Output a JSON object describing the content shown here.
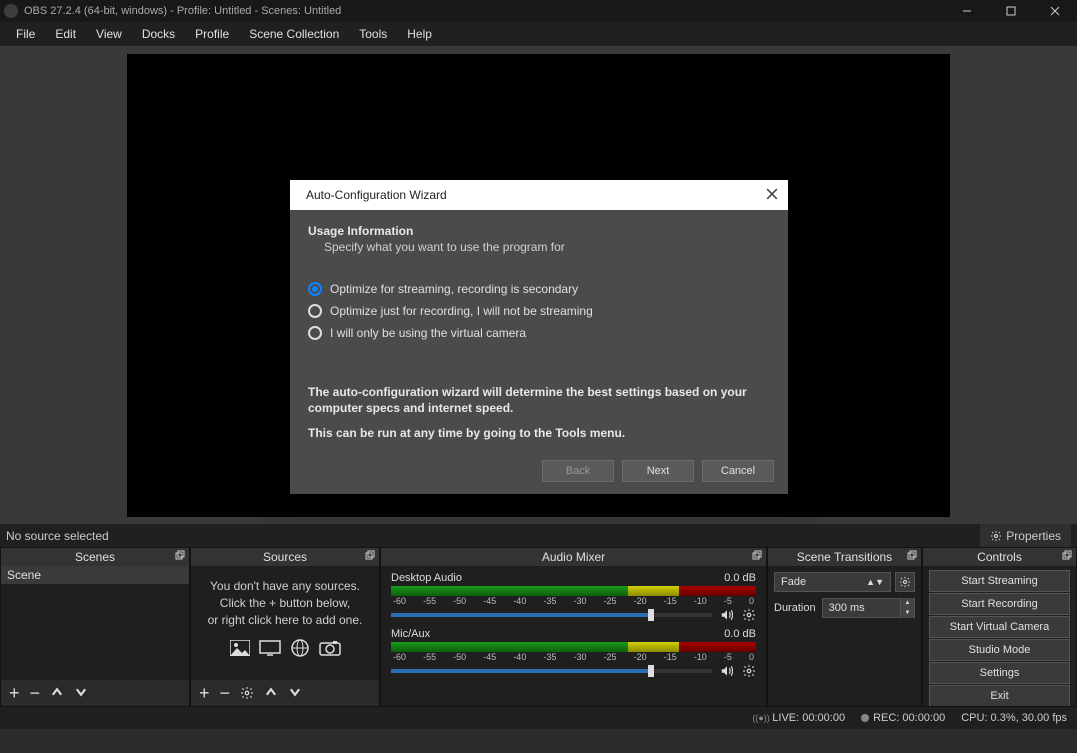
{
  "titlebar": {
    "text": "OBS 27.2.4 (64-bit, windows) - Profile: Untitled - Scenes: Untitled"
  },
  "menubar": [
    "File",
    "Edit",
    "View",
    "Docks",
    "Profile",
    "Scene Collection",
    "Tools",
    "Help"
  ],
  "sourcebar": {
    "none": "No source selected",
    "properties": "Properties"
  },
  "panels": {
    "scenes": {
      "title": "Scenes",
      "items": [
        "Scene"
      ]
    },
    "sources": {
      "title": "Sources",
      "empty1": "You don't have any sources.",
      "empty2": "Click the + button below,",
      "empty3": "or right click here to add one."
    },
    "audio": {
      "title": "Audio Mixer",
      "tracks": [
        {
          "name": "Desktop Audio",
          "db": "0.0 dB"
        },
        {
          "name": "Mic/Aux",
          "db": "0.0 dB"
        }
      ],
      "ticks": [
        "-60",
        "-55",
        "-50",
        "-45",
        "-40",
        "-35",
        "-30",
        "-25",
        "-20",
        "-15",
        "-10",
        "-5",
        "0"
      ]
    },
    "transitions": {
      "title": "Scene Transitions",
      "selected": "Fade",
      "durationLabel": "Duration",
      "duration": "300 ms"
    },
    "controls": {
      "title": "Controls",
      "buttons": [
        "Start Streaming",
        "Start Recording",
        "Start Virtual Camera",
        "Studio Mode",
        "Settings",
        "Exit"
      ]
    }
  },
  "status": {
    "live": "LIVE: 00:00:00",
    "rec": "REC: 00:00:00",
    "cpu": "CPU: 0.3%, 30.00 fps"
  },
  "wizard": {
    "title": "Auto-Configuration Wizard",
    "header": "Usage Information",
    "sub": "Specify what you want to use the program for",
    "options": [
      "Optimize for streaming, recording is secondary",
      "Optimize just for recording, I will not be streaming",
      "I will only be using the virtual camera"
    ],
    "selected": 0,
    "desc1": "The auto-configuration wizard will determine the best settings based on your computer specs and internet speed.",
    "desc2": "This can be run at any time by going to the Tools menu.",
    "back": "Back",
    "next": "Next",
    "cancel": "Cancel"
  }
}
